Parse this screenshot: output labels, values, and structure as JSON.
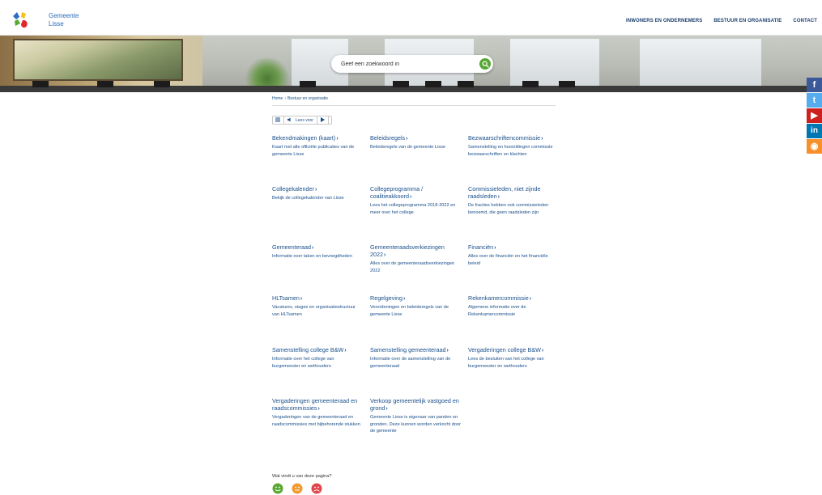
{
  "header": {
    "logo_line1": "Gemeente",
    "logo_line2": "Lisse",
    "nav": [
      "INWONERS EN ONDERNEMERS",
      "BESTUUR EN ORGANISATIE",
      "CONTACT"
    ]
  },
  "search": {
    "placeholder": "Geef een zoekwoord in",
    "button_icon": "search-icon"
  },
  "social": [
    {
      "name": "facebook-icon",
      "glyph": "f",
      "color": "#3b5998"
    },
    {
      "name": "twitter-icon",
      "glyph": "t",
      "color": "#55acee"
    },
    {
      "name": "youtube-icon",
      "glyph": "▶",
      "color": "#cd201f"
    },
    {
      "name": "linkedin-icon",
      "glyph": "in",
      "color": "#0077b5"
    },
    {
      "name": "rss-icon",
      "glyph": "◉",
      "color": "#f7902a"
    }
  ],
  "breadcrumb": {
    "home": "Home",
    "separator": "›",
    "current": "Bestuur en organisatie"
  },
  "readspeaker": {
    "label": "Lees voor"
  },
  "items": [
    {
      "title": "Bekendmakingen (kaart)",
      "desc": "Kaart met alle officiële publicaties van de gemeente Lisse"
    },
    {
      "title": "Beleidsregels",
      "desc": "Beleidsregels van de gemeente Lisse"
    },
    {
      "title": "Bezwaarschriftencommissie",
      "desc": "Samenstelling en hoorzittingen commissie bezwaarschriften en klachten"
    },
    {
      "title": "Collegekalender",
      "desc": "Bekijk de collegekalender van Lisse"
    },
    {
      "title": "Collegeprogramma / coalitieakkoord",
      "desc": "Lees het collegeprogramma 2018-2022 en meer over het college"
    },
    {
      "title": "Commissieleden, niet zijnde raadsleden",
      "desc": "De fracties hebben ook commissieleden benoemd, die geen raadsleden zijn"
    },
    {
      "title": "Gemeenteraad",
      "desc": "Informatie over taken en bevoegdheden"
    },
    {
      "title": "Gemeenteraadsverkiezingen 2022",
      "desc": "Alles over de gemeenteraadsverkiezingen 2022"
    },
    {
      "title": "Financiën",
      "desc": "Alles over de financiën en het financiële beleid"
    },
    {
      "title": "HLTsamen",
      "desc": "Vacatures, stages en organisatiestructuur van HLTsamen"
    },
    {
      "title": "Regelgeving",
      "desc": "Verordeningen en beleidsregels van de gemeente Lisse"
    },
    {
      "title": "Rekenkamercommissie",
      "desc": "Algemene informatie over de Rekenkamercommissie"
    },
    {
      "title": "Samenstelling college B&W",
      "desc": "Informatie over het college van burgemeester en wethouders"
    },
    {
      "title": "Samenstelling gemeenteraad",
      "desc": "Informatie over de samenstelling van de gemeenteraad"
    },
    {
      "title": "Vergaderingen college B&W",
      "desc": "Lees de besluiten van het college van burgemeester en wethouders"
    },
    {
      "title": "Vergaderingen gemeenteraad en raadscommissies",
      "desc": "Vergaderingen van de gemeenteraad en raadscommissies met bijbehorende stukken"
    },
    {
      "title": "Verkoop gemeentelijk vastgoed en grond",
      "desc": "Gemeente Lisse is eigenaar van panden en gronden. Deze kunnen worden verkocht door de gemeente"
    }
  ],
  "feedback": {
    "question": "Wat vindt u van deze pagina?",
    "faces": [
      {
        "name": "happy-face-icon",
        "color": "#5aa832"
      },
      {
        "name": "neutral-face-icon",
        "color": "#f29a2e"
      },
      {
        "name": "sad-face-icon",
        "color": "#e0474c"
      }
    ]
  },
  "colors": {
    "link": "#1a4f8b",
    "accent_green": "#55a632"
  }
}
